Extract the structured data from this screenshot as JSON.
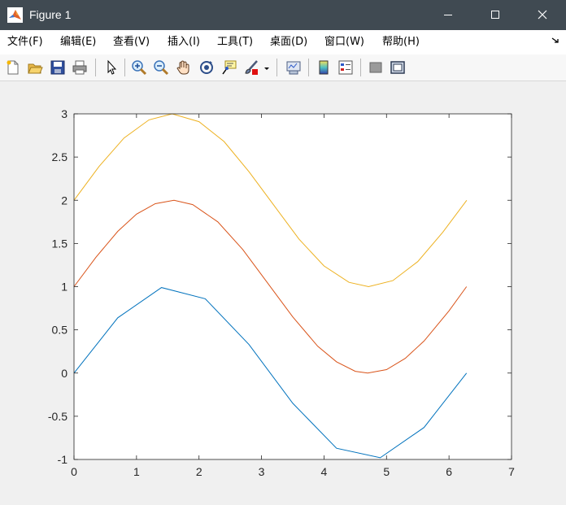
{
  "window": {
    "title": "Figure 1"
  },
  "menu": {
    "items": [
      {
        "label": "文件(F)"
      },
      {
        "label": "编辑(E)"
      },
      {
        "label": "查看(V)"
      },
      {
        "label": "插入(I)"
      },
      {
        "label": "工具(T)"
      },
      {
        "label": "桌面(D)"
      },
      {
        "label": "窗口(W)"
      },
      {
        "label": "帮助(H)"
      }
    ]
  },
  "toolbar": {
    "icons": [
      "new-figure-icon",
      "open-file-icon",
      "save-icon",
      "print-icon",
      "select-pointer-icon",
      "zoom-in-icon",
      "zoom-out-icon",
      "pan-hand-icon",
      "rotate-3d-icon",
      "data-cursor-icon",
      "brush-icon",
      "brush-dropdown-icon",
      "link-plot-icon",
      "insert-colorbar-icon",
      "insert-legend-icon",
      "hide-plot-tools-icon",
      "show-plot-tools-icon"
    ]
  },
  "colors": {
    "titlebar": "#404a52",
    "series1": "#0072bd",
    "series2": "#d95319",
    "series3": "#edb120"
  },
  "chart_data": {
    "type": "line",
    "title": "",
    "xlabel": "",
    "ylabel": "",
    "xlim": [
      0,
      7
    ],
    "ylim": [
      -1,
      3
    ],
    "xticks": [
      0,
      1,
      2,
      3,
      4,
      5,
      6,
      7
    ],
    "yticks": [
      -1,
      -0.5,
      0,
      0.5,
      1,
      1.5,
      2,
      2.5,
      3
    ],
    "ytick_labels": [
      "-1",
      "-0.5",
      "0",
      "0.5",
      "1",
      "1.5",
      "2",
      "2.5",
      "3"
    ],
    "grid": false,
    "series": [
      {
        "color": "#0072bd",
        "x": [
          0,
          0.7,
          1.4,
          2.1,
          2.8,
          3.5,
          4.2,
          4.9,
          5.6,
          6.28
        ],
        "y": [
          0,
          0.64,
          0.99,
          0.86,
          0.33,
          -0.35,
          -0.87,
          -0.98,
          -0.63,
          0
        ]
      },
      {
        "color": "#d95319",
        "x": [
          0,
          0.35,
          0.7,
          1.0,
          1.3,
          1.6,
          1.9,
          2.3,
          2.7,
          3.1,
          3.5,
          3.9,
          4.2,
          4.5,
          4.7,
          5.0,
          5.3,
          5.6,
          6.0,
          6.28
        ],
        "y": [
          1.0,
          1.34,
          1.64,
          1.84,
          1.96,
          2.0,
          1.95,
          1.75,
          1.43,
          1.04,
          0.65,
          0.31,
          0.13,
          0.02,
          0.0,
          0.04,
          0.17,
          0.37,
          0.72,
          1.0
        ]
      },
      {
        "color": "#edb120",
        "x": [
          0,
          0.4,
          0.8,
          1.2,
          1.5708,
          2.0,
          2.4,
          2.8,
          3.2,
          3.6,
          4.0,
          4.4,
          4.7124,
          5.1,
          5.5,
          5.9,
          6.2832
        ],
        "y": [
          2.0,
          2.39,
          2.72,
          2.93,
          3.0,
          2.91,
          2.68,
          2.33,
          1.94,
          1.55,
          1.24,
          1.05,
          1.0,
          1.07,
          1.29,
          1.63,
          2.0
        ]
      }
    ]
  }
}
